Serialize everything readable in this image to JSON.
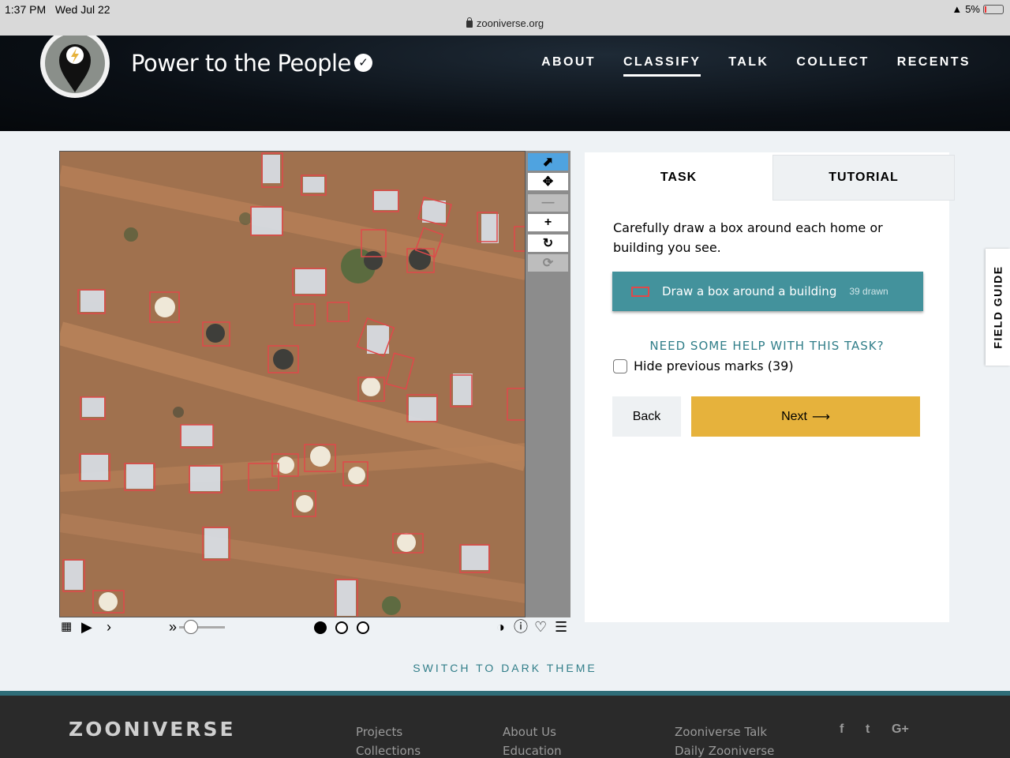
{
  "status_bar": {
    "time": "1:37 PM",
    "date": "Wed Jul 22",
    "battery": "5%",
    "url": "zooniverse.org"
  },
  "header": {
    "project_title": "Power to the People",
    "nav": [
      {
        "label": "ABOUT",
        "active": false
      },
      {
        "label": "CLASSIFY",
        "active": true
      },
      {
        "label": "TALK",
        "active": false
      },
      {
        "label": "COLLECT",
        "active": false
      },
      {
        "label": "RECENTS",
        "active": false
      }
    ]
  },
  "viewer": {
    "toolbar_icons": [
      "pointer-icon",
      "pan-icon",
      "zoom-out-icon",
      "zoom-in-icon",
      "rotate-icon",
      "reset-icon"
    ],
    "frames": 3,
    "active_frame": 1
  },
  "task_panel": {
    "tabs": [
      "TASK",
      "TUTORIAL"
    ],
    "instructions": "Carefully draw a box around each home or building you see.",
    "draw_tool_label": "Draw a box around a building",
    "draw_tool_count": "39 drawn",
    "help_link": "NEED SOME HELP WITH THIS TASK?",
    "hide_marks_label": "Hide previous marks (39)",
    "back_label": "Back",
    "next_label": "Next",
    "accent_color": "#43929c",
    "next_color": "#e6b23c",
    "mark_color": "#e0484a"
  },
  "field_guide": "FIELD GUIDE",
  "dark_theme_link": "SWITCH TO DARK THEME",
  "footer": {
    "logo": "ZOONIVERSE",
    "col1": [
      "Projects",
      "Collections"
    ],
    "col2": [
      "About Us",
      "Education"
    ],
    "col3": [
      "Zooniverse Talk",
      "Daily Zooniverse"
    ],
    "social": [
      "f",
      "t",
      "G+"
    ]
  }
}
